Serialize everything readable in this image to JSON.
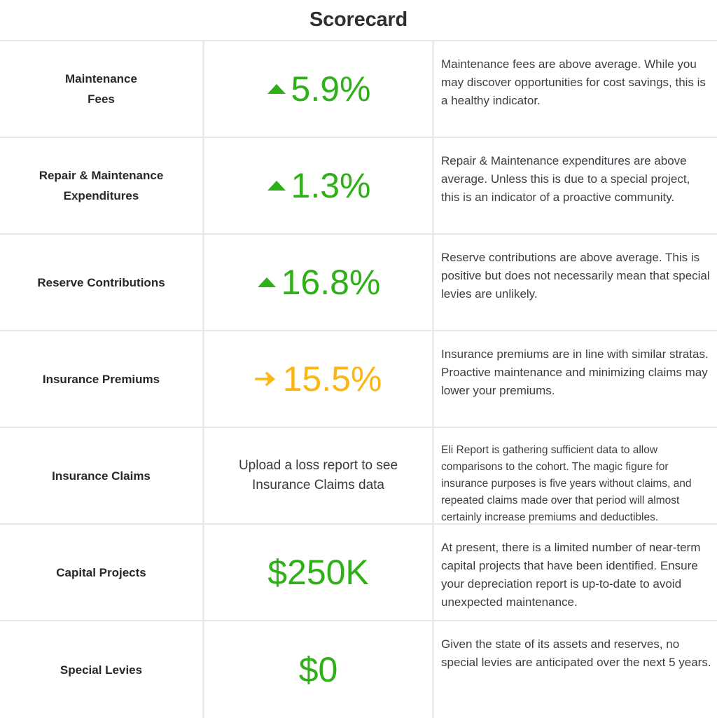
{
  "header": {
    "title": "Scorecard"
  },
  "colors": {
    "positive": "#2eb017",
    "neutral": "#fbb615",
    "text": "#3a3f44",
    "label": "#26292c",
    "border": "#e8e8ea"
  },
  "rows": [
    {
      "label_line1": "Maintenance",
      "label_line2": "Fees",
      "metric_kind": "value",
      "trend": "up",
      "arrow_icon": "triangle-up-icon",
      "value": "5.9%",
      "note": "Maintenance fees are above average. While you may discover opportunities for cost savings, this is a healthy indicator.",
      "note_size": "normal"
    },
    {
      "label_line1": "Repair & Maintenance",
      "label_line2": "Expenditures",
      "metric_kind": "value",
      "trend": "up",
      "arrow_icon": "triangle-up-icon",
      "value": "1.3%",
      "note": "Repair & Maintenance expenditures are above average. Unless this is due to a special project, this is an indicator of a proactive community.",
      "note_size": "normal"
    },
    {
      "label_line1": "Reserve Contributions",
      "label_line2": "",
      "metric_kind": "value",
      "trend": "up",
      "arrow_icon": "triangle-up-icon",
      "value": "16.8%",
      "note": "Reserve contributions are above average. This is positive but does not necessarily mean that special levies are unlikely.",
      "note_size": "normal"
    },
    {
      "label_line1": "Insurance Premiums",
      "label_line2": "",
      "metric_kind": "value",
      "trend": "flat",
      "arrow_icon": "arrow-right-icon",
      "value": "15.5%",
      "note": "Insurance premiums are in line with similar stratas. Proactive maintenance and minimizing claims may lower your premiums.",
      "note_size": "normal"
    },
    {
      "label_line1": "Insurance Claims",
      "label_line2": "",
      "metric_kind": "text",
      "trend": "none",
      "arrow_icon": "",
      "value": "Upload a loss report to see Insurance Claims data",
      "note": "Eli Report is gathering sufficient data to allow comparisons to the cohort. The magic figure for insurance purposes is five years without claims, and repeated claims made over that period will almost certainly increase premiums and deductibles.",
      "note_size": "small"
    },
    {
      "label_line1": "Capital Projects",
      "label_line2": "",
      "metric_kind": "money",
      "trend": "money",
      "arrow_icon": "",
      "value": "$250K",
      "note": "At present, there is a limited number of near-term capital projects that have been identified. Ensure your depreciation report is up-to-date to avoid unexpected maintenance.",
      "note_size": "normal"
    },
    {
      "label_line1": "Special Levies",
      "label_line2": "",
      "metric_kind": "money",
      "trend": "money",
      "arrow_icon": "",
      "value": "$0",
      "note": "Given the state of its assets and reserves, no special levies are anticipated over the next 5 years.",
      "note_size": "normal"
    }
  ]
}
